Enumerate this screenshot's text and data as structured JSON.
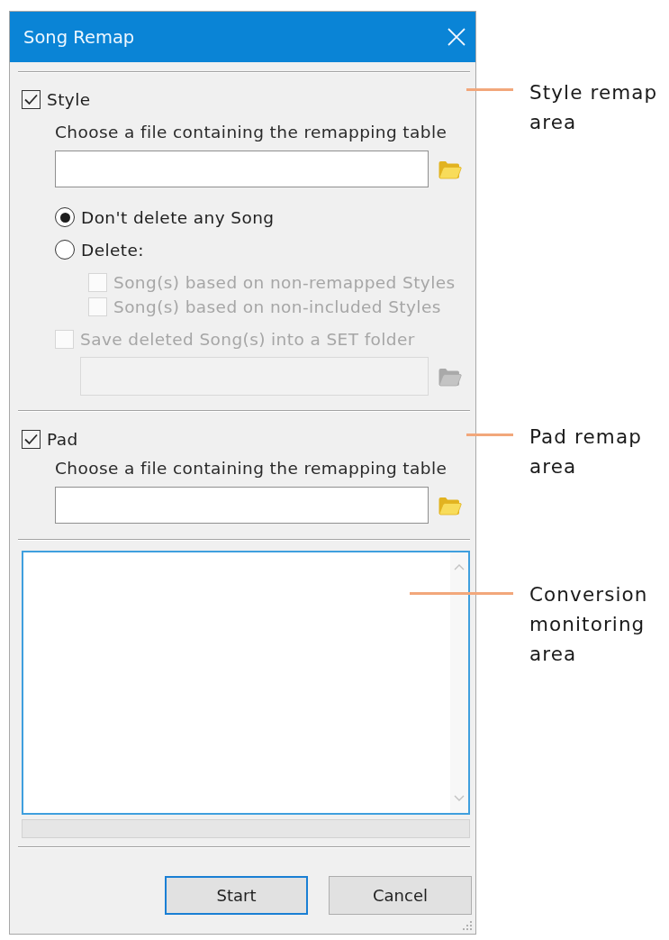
{
  "window": {
    "title": "Song Remap"
  },
  "style_section": {
    "label": "Style",
    "checked": true,
    "file_prompt": "Choose a file containing the remapping table",
    "delete_modes": [
      {
        "label": "Don't delete any Song",
        "selected": true
      },
      {
        "label": "Delete:",
        "selected": false
      }
    ],
    "delete_options": [
      {
        "label": "Song(s) based on non-remapped Styles",
        "checked": false,
        "disabled": true
      },
      {
        "label": "Song(s) based on non-included Styles",
        "checked": false,
        "disabled": true
      }
    ],
    "save_option": {
      "label": "Save deleted Song(s) into a SET folder",
      "checked": false,
      "disabled": true
    },
    "set_folder": {
      "disabled": true
    }
  },
  "pad_section": {
    "label": "Pad",
    "checked": true,
    "file_prompt": "Choose a file containing the remapping table"
  },
  "buttons": [
    {
      "label": "Start",
      "focused": true
    },
    {
      "label": "Cancel",
      "focused": false
    }
  ],
  "callouts": [
    {
      "label": "Style remap area"
    },
    {
      "label": "Pad remap area"
    },
    {
      "label": "Conversion monitoring area"
    }
  ]
}
